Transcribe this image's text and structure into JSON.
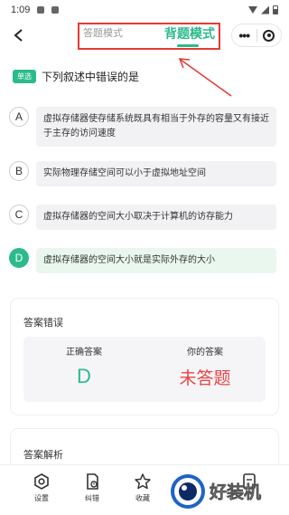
{
  "status_bar": {
    "time": "1:09"
  },
  "header": {
    "tabs": [
      {
        "label": "答题模式",
        "active": false
      },
      {
        "label": "背题模式",
        "active": true
      }
    ],
    "more_icon": "more-dots-icon",
    "close_icon": "target-icon"
  },
  "question": {
    "type_badge": "单选",
    "text": "下列叙述中错误的是",
    "options": [
      {
        "letter": "A",
        "text": "虚拟存储器使存储系统既具有相当于外存的容量又有接近于主存的访问速度"
      },
      {
        "letter": "B",
        "text": "实际物理存储空间可以小于虚拟地址空间"
      },
      {
        "letter": "C",
        "text": "虚拟存储器的空间大小取决于计算机的访存能力"
      },
      {
        "letter": "D",
        "text": "虚拟存储器的空间大小就是实际外存的大小",
        "correct": true
      }
    ]
  },
  "result": {
    "title": "答案错误",
    "correct_label": "正确答案",
    "correct_value": "D",
    "yours_label": "你的答案",
    "yours_value": "未答题"
  },
  "analysis": {
    "title": "答案解析"
  },
  "bottom_bar": {
    "items": [
      {
        "label": "设置",
        "icon": "settings-icon"
      },
      {
        "label": "纠错",
        "icon": "feedback-icon"
      },
      {
        "label": "收藏",
        "icon": "star-icon"
      }
    ]
  },
  "colors": {
    "accent": "#2bbb8a",
    "wrong": "#e64545",
    "annotation": "#e53935"
  }
}
